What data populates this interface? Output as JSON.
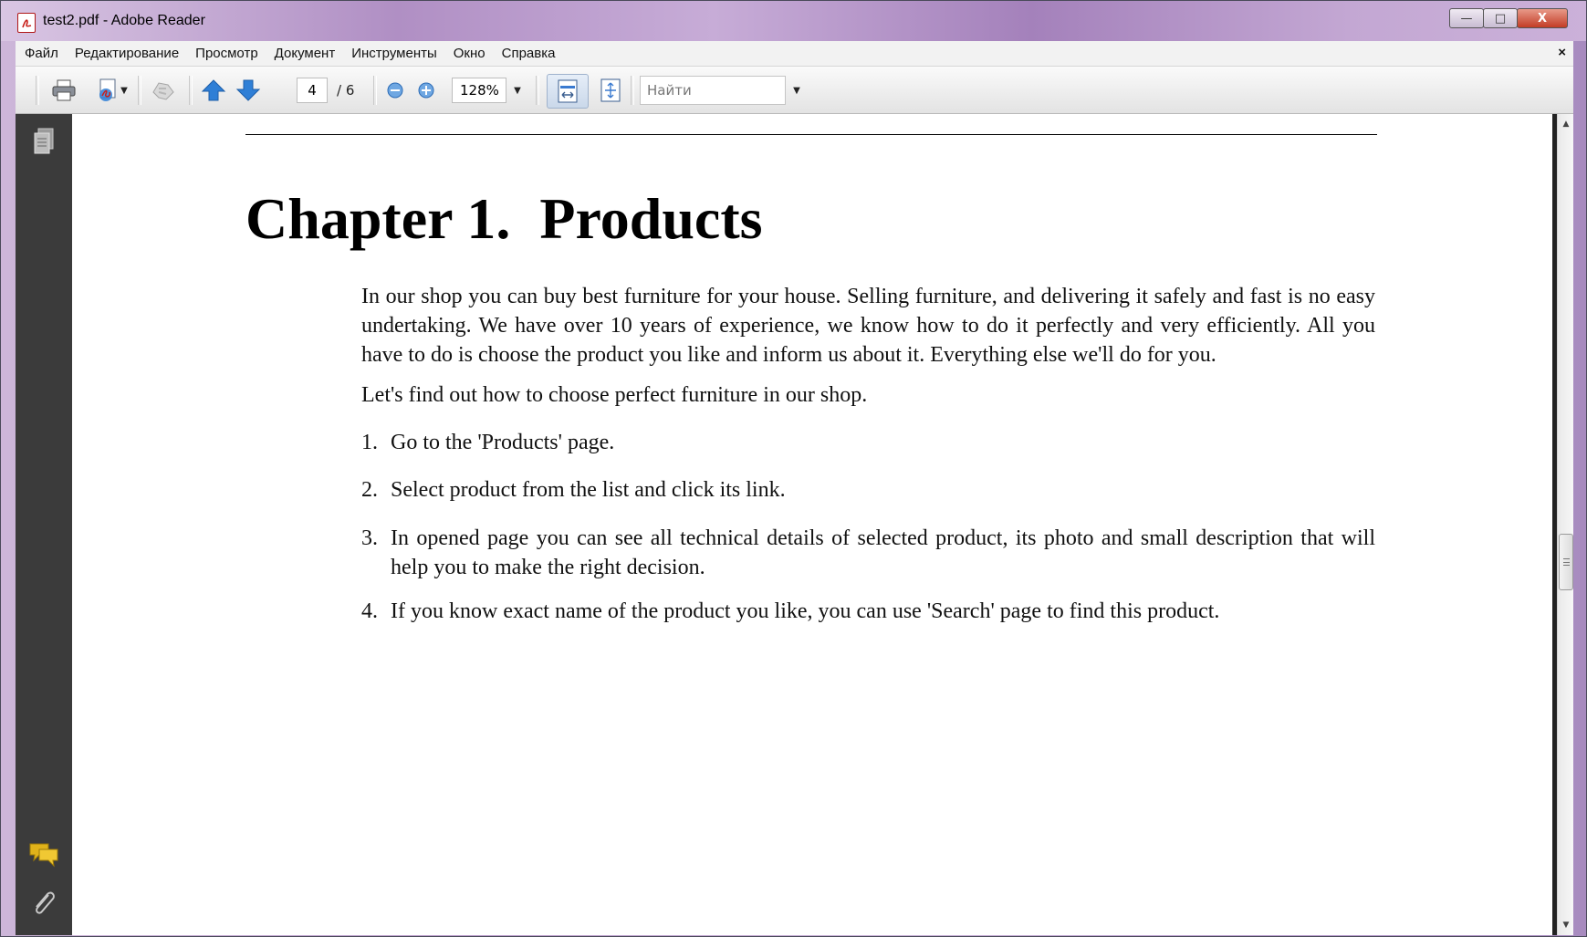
{
  "window": {
    "title": "test2.pdf - Adobe Reader",
    "controls": {
      "minimize": "—",
      "maximize": "□",
      "close": "X"
    }
  },
  "menu": {
    "items": [
      "Файл",
      "Редактирование",
      "Просмотр",
      "Документ",
      "Инструменты",
      "Окно",
      "Справка"
    ],
    "close_doc": "×"
  },
  "toolbar": {
    "current_page": "4",
    "total_pages": "/ 6",
    "zoom": "128%",
    "find_placeholder": "Найти"
  },
  "document": {
    "chapter_title": "Chapter 1.  Products",
    "intro": "In our shop you can buy best furniture for your house. Selling furniture, and delivering it safely and fast is no easy undertaking. We have over 10 years of experience, we know how to do it perfectly and very efficiently. All you have to do is choose the product you like and inform us about it. Everything else we'll do for you.",
    "lead": "Let's find out how to choose perfect furniture in our shop.",
    "steps": [
      {
        "num": "1.",
        "text": "Go to the 'Products' page."
      },
      {
        "num": "2.",
        "text": "Select product from the list and click its link."
      },
      {
        "num": "3.",
        "text": "In opened page you can see all technical details of selected product, its photo and small description that will help you to make the right decision."
      },
      {
        "num": "4.",
        "text": "If you know exact name of the product you like, you can use 'Search' page to find this product."
      }
    ]
  },
  "icons": {
    "app": "pdf-icon",
    "print": "printer-icon",
    "create": "create-pdf-icon",
    "collaborate": "collaborate-icon",
    "prev_page": "arrow-up-icon",
    "next_page": "arrow-down-icon",
    "zoom_out": "zoom-out-icon",
    "zoom_in": "zoom-in-icon",
    "fit_width": "fit-width-icon",
    "fit_page": "fit-page-icon",
    "pages_panel": "pages-icon",
    "comments": "comments-icon",
    "attachments": "paperclip-icon"
  },
  "colors": {
    "nav_panel": "#3b3b3b",
    "accent_blue": "#2f7fd6",
    "pdf_red": "#c8201a",
    "comment_yellow": "#e0b21a"
  }
}
